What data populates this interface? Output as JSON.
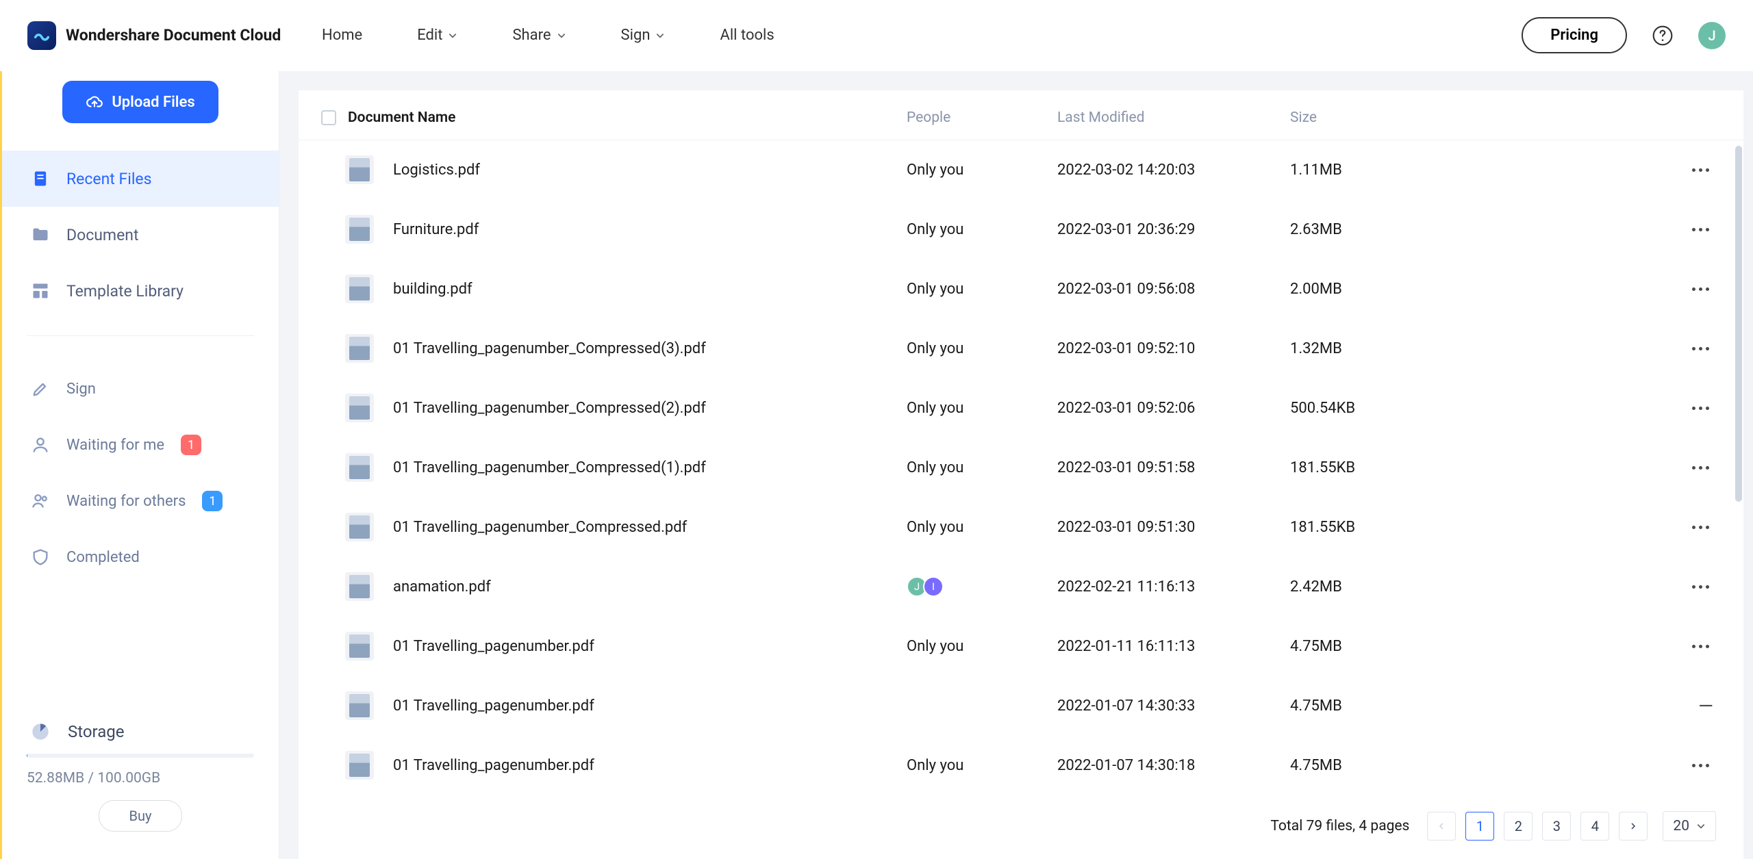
{
  "brand": {
    "name": "Wondershare Document Cloud"
  },
  "nav": {
    "home": "Home",
    "edit": "Edit",
    "share": "Share",
    "sign": "Sign",
    "all_tools": "All tools"
  },
  "topbar": {
    "pricing_label": "Pricing",
    "avatar_initial": "J"
  },
  "sidebar": {
    "upload_label": "Upload Files",
    "recent": "Recent Files",
    "document": "Document",
    "template_library": "Template Library",
    "sign": "Sign",
    "waiting_me": "Waiting for me",
    "waiting_me_badge": "1",
    "waiting_others": "Waiting for others",
    "waiting_others_badge": "1",
    "completed": "Completed",
    "storage_label": "Storage",
    "storage_usage": "52.88MB / 100.00GB",
    "buy_label": "Buy"
  },
  "table": {
    "headers": {
      "name": "Document Name",
      "people": "People",
      "modified": "Last Modified",
      "size": "Size"
    },
    "rows": [
      {
        "name": "Logistics.pdf",
        "people": "Only you",
        "modified": "2022-03-02 14:20:03",
        "size": "1.11MB"
      },
      {
        "name": "Furniture.pdf",
        "people": "Only you",
        "modified": "2022-03-01 20:36:29",
        "size": "2.63MB"
      },
      {
        "name": "building.pdf",
        "people": "Only you",
        "modified": "2022-03-01 09:56:08",
        "size": "2.00MB"
      },
      {
        "name": "01 Travelling_pagenumber_Compressed(3).pdf",
        "people": "Only you",
        "modified": "2022-03-01 09:52:10",
        "size": "1.32MB"
      },
      {
        "name": "01 Travelling_pagenumber_Compressed(2).pdf",
        "people": "Only you",
        "modified": "2022-03-01 09:52:06",
        "size": "500.54KB"
      },
      {
        "name": "01 Travelling_pagenumber_Compressed(1).pdf",
        "people": "Only you",
        "modified": "2022-03-01 09:51:58",
        "size": "181.55KB"
      },
      {
        "name": "01 Travelling_pagenumber_Compressed.pdf",
        "people": "Only you",
        "modified": "2022-03-01 09:51:30",
        "size": "181.55KB"
      },
      {
        "name": "anamation.pdf",
        "people": "avatars",
        "modified": "2022-02-21 11:16:13",
        "size": "2.42MB",
        "avatars": [
          "J",
          "I"
        ]
      },
      {
        "name": "01 Travelling_pagenumber.pdf",
        "people": "Only you",
        "modified": "2022-01-11 16:11:13",
        "size": "4.75MB"
      },
      {
        "name": "01 Travelling_pagenumber.pdf",
        "people": "",
        "modified": "2022-01-07 14:30:33",
        "size": "4.75MB",
        "no_actions": true
      },
      {
        "name": "01 Travelling_pagenumber.pdf",
        "people": "Only you",
        "modified": "2022-01-07 14:30:18",
        "size": "4.75MB"
      }
    ]
  },
  "pagination": {
    "total_text": "Total 79 files, 4 pages",
    "pages": [
      "1",
      "2",
      "3",
      "4"
    ],
    "active": "1",
    "page_size": "20"
  }
}
